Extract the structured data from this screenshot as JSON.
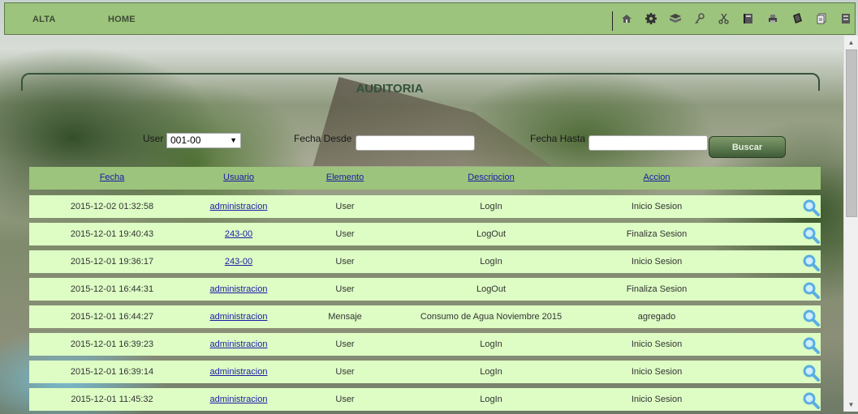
{
  "nav": {
    "alta": "ALTA",
    "home": "HOME"
  },
  "toolbar_icons": [
    "home-icon",
    "gear-icon",
    "book-icon",
    "key-icon",
    "scissors-icon",
    "notebook-icon",
    "printer-icon",
    "tablet-icon",
    "documents-icon",
    "server-icon"
  ],
  "page_title": "AUDITORIA",
  "filters": {
    "user_label": "User",
    "user_selected": "001-00",
    "fecha_desde_label": "Fecha Desde",
    "fecha_desde_value": "",
    "fecha_hasta_label": "Fecha Hasta",
    "fecha_hasta_value": "",
    "buscar_label": "Buscar"
  },
  "table": {
    "headers": [
      "Fecha",
      "Usuario",
      "Elemento",
      "Descripcion",
      "Accion"
    ],
    "rows": [
      {
        "fecha": "2015-12-02 01:32:58",
        "usuario": "administracion",
        "elemento": "User",
        "descripcion": "LogIn",
        "accion": "Inicio Sesion"
      },
      {
        "fecha": "2015-12-01 19:40:43",
        "usuario": "243-00",
        "elemento": "User",
        "descripcion": "LogOut",
        "accion": "Finaliza Sesion"
      },
      {
        "fecha": "2015-12-01 19:36:17",
        "usuario": "243-00",
        "elemento": "User",
        "descripcion": "LogIn",
        "accion": "Inicio Sesion"
      },
      {
        "fecha": "2015-12-01 16:44:31",
        "usuario": "administracion",
        "elemento": "User",
        "descripcion": "LogOut",
        "accion": "Finaliza Sesion"
      },
      {
        "fecha": "2015-12-01 16:44:27",
        "usuario": "administracion",
        "elemento": "Mensaje",
        "descripcion": "Consumo de Agua Noviembre 2015",
        "accion": "agregado"
      },
      {
        "fecha": "2015-12-01 16:39:23",
        "usuario": "administracion",
        "elemento": "User",
        "descripcion": "LogIn",
        "accion": "Inicio Sesion"
      },
      {
        "fecha": "2015-12-01 16:39:14",
        "usuario": "administracion",
        "elemento": "User",
        "descripcion": "LogIn",
        "accion": "Inicio Sesion"
      },
      {
        "fecha": "2015-12-01 11:45:32",
        "usuario": "administracion",
        "elemento": "User",
        "descripcion": "LogIn",
        "accion": "Inicio Sesion"
      }
    ]
  },
  "colors": {
    "header_green": "#9cc47c",
    "row_green": "#ddfdc4",
    "title_green": "#32513a",
    "link_blue": "#1a1aa6",
    "magnifier_blue": "#5aaee0"
  }
}
